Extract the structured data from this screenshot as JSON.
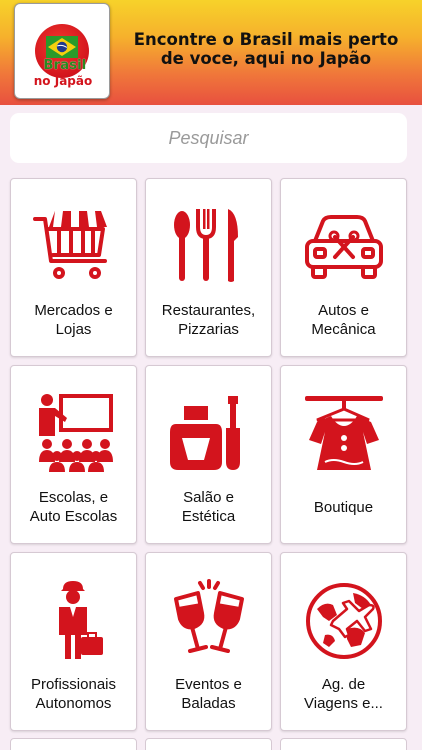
{
  "header": {
    "logo": {
      "line1": "Brasil",
      "line2": "no Japão"
    },
    "tagline": {
      "line1": "Encontre o Brasil mais perto",
      "line2": "de voce, aqui no Japão"
    }
  },
  "search": {
    "placeholder": "Pesquisar",
    "value": ""
  },
  "colors": {
    "accent": "#d3141d",
    "icon": "#d3141d"
  },
  "categories": [
    {
      "label": "Mercados e\nLojas",
      "icon": "shopping-cart-store-icon"
    },
    {
      "label": "Restaurantes,\nPizzarias",
      "icon": "cutlery-icon"
    },
    {
      "label": "Autos e\nMecânica",
      "icon": "car-repair-icon"
    },
    {
      "label": "Escolas, e\nAuto Escolas",
      "icon": "classroom-icon"
    },
    {
      "label": "Salão e\nEstética",
      "icon": "nail-polish-icon"
    },
    {
      "label": "Boutique",
      "icon": "dress-hanger-icon"
    },
    {
      "label": "Profissionais\nAutonomos",
      "icon": "worker-briefcase-icon"
    },
    {
      "label": "Eventos e\nBaladas",
      "icon": "cheers-glasses-icon"
    },
    {
      "label": "Ag. de\nViagens e...",
      "icon": "travel-globe-plane-icon"
    }
  ]
}
